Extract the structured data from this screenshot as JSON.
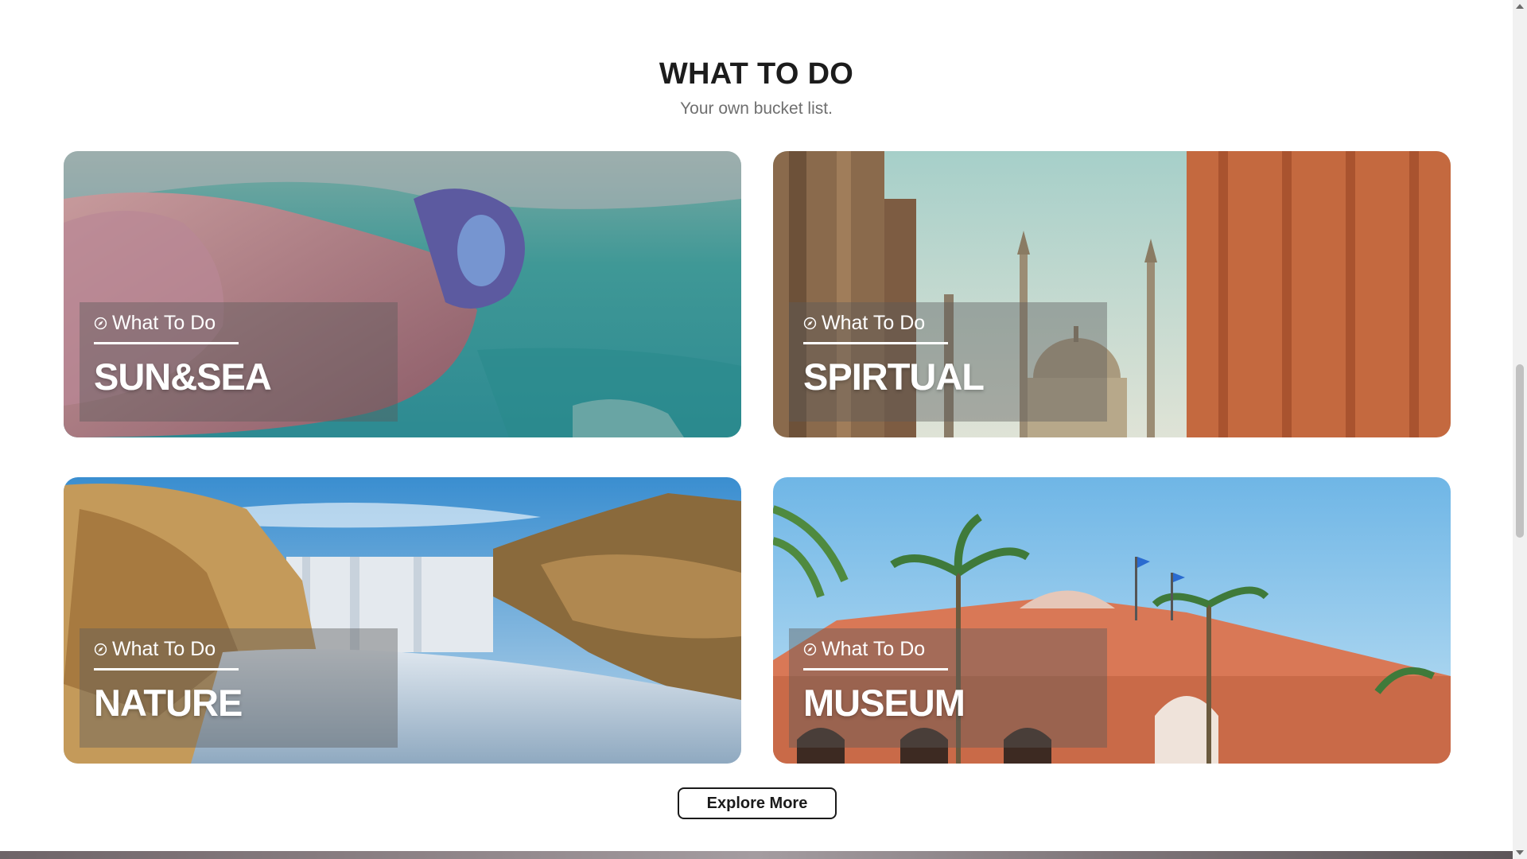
{
  "section": {
    "title": "WHAT TO DO",
    "subtitle": "Your own bucket list."
  },
  "cards": [
    {
      "kicker": "What To Do",
      "title": "SUN&SEA",
      "icon": "compass-icon"
    },
    {
      "kicker": "What To Do",
      "title": "SPIRTUAL",
      "icon": "compass-icon"
    },
    {
      "kicker": "What To Do",
      "title": "NATURE",
      "icon": "compass-icon"
    },
    {
      "kicker": "What To Do",
      "title": "MUSEUM",
      "icon": "compass-icon"
    }
  ],
  "explore_button": {
    "label": "Explore More"
  },
  "colors": {
    "title_text": "#1c1c1c",
    "subtitle_text": "#6f6f6f",
    "overlay": "rgba(90,90,90,0.42)",
    "button_border": "#1a1a1a"
  }
}
